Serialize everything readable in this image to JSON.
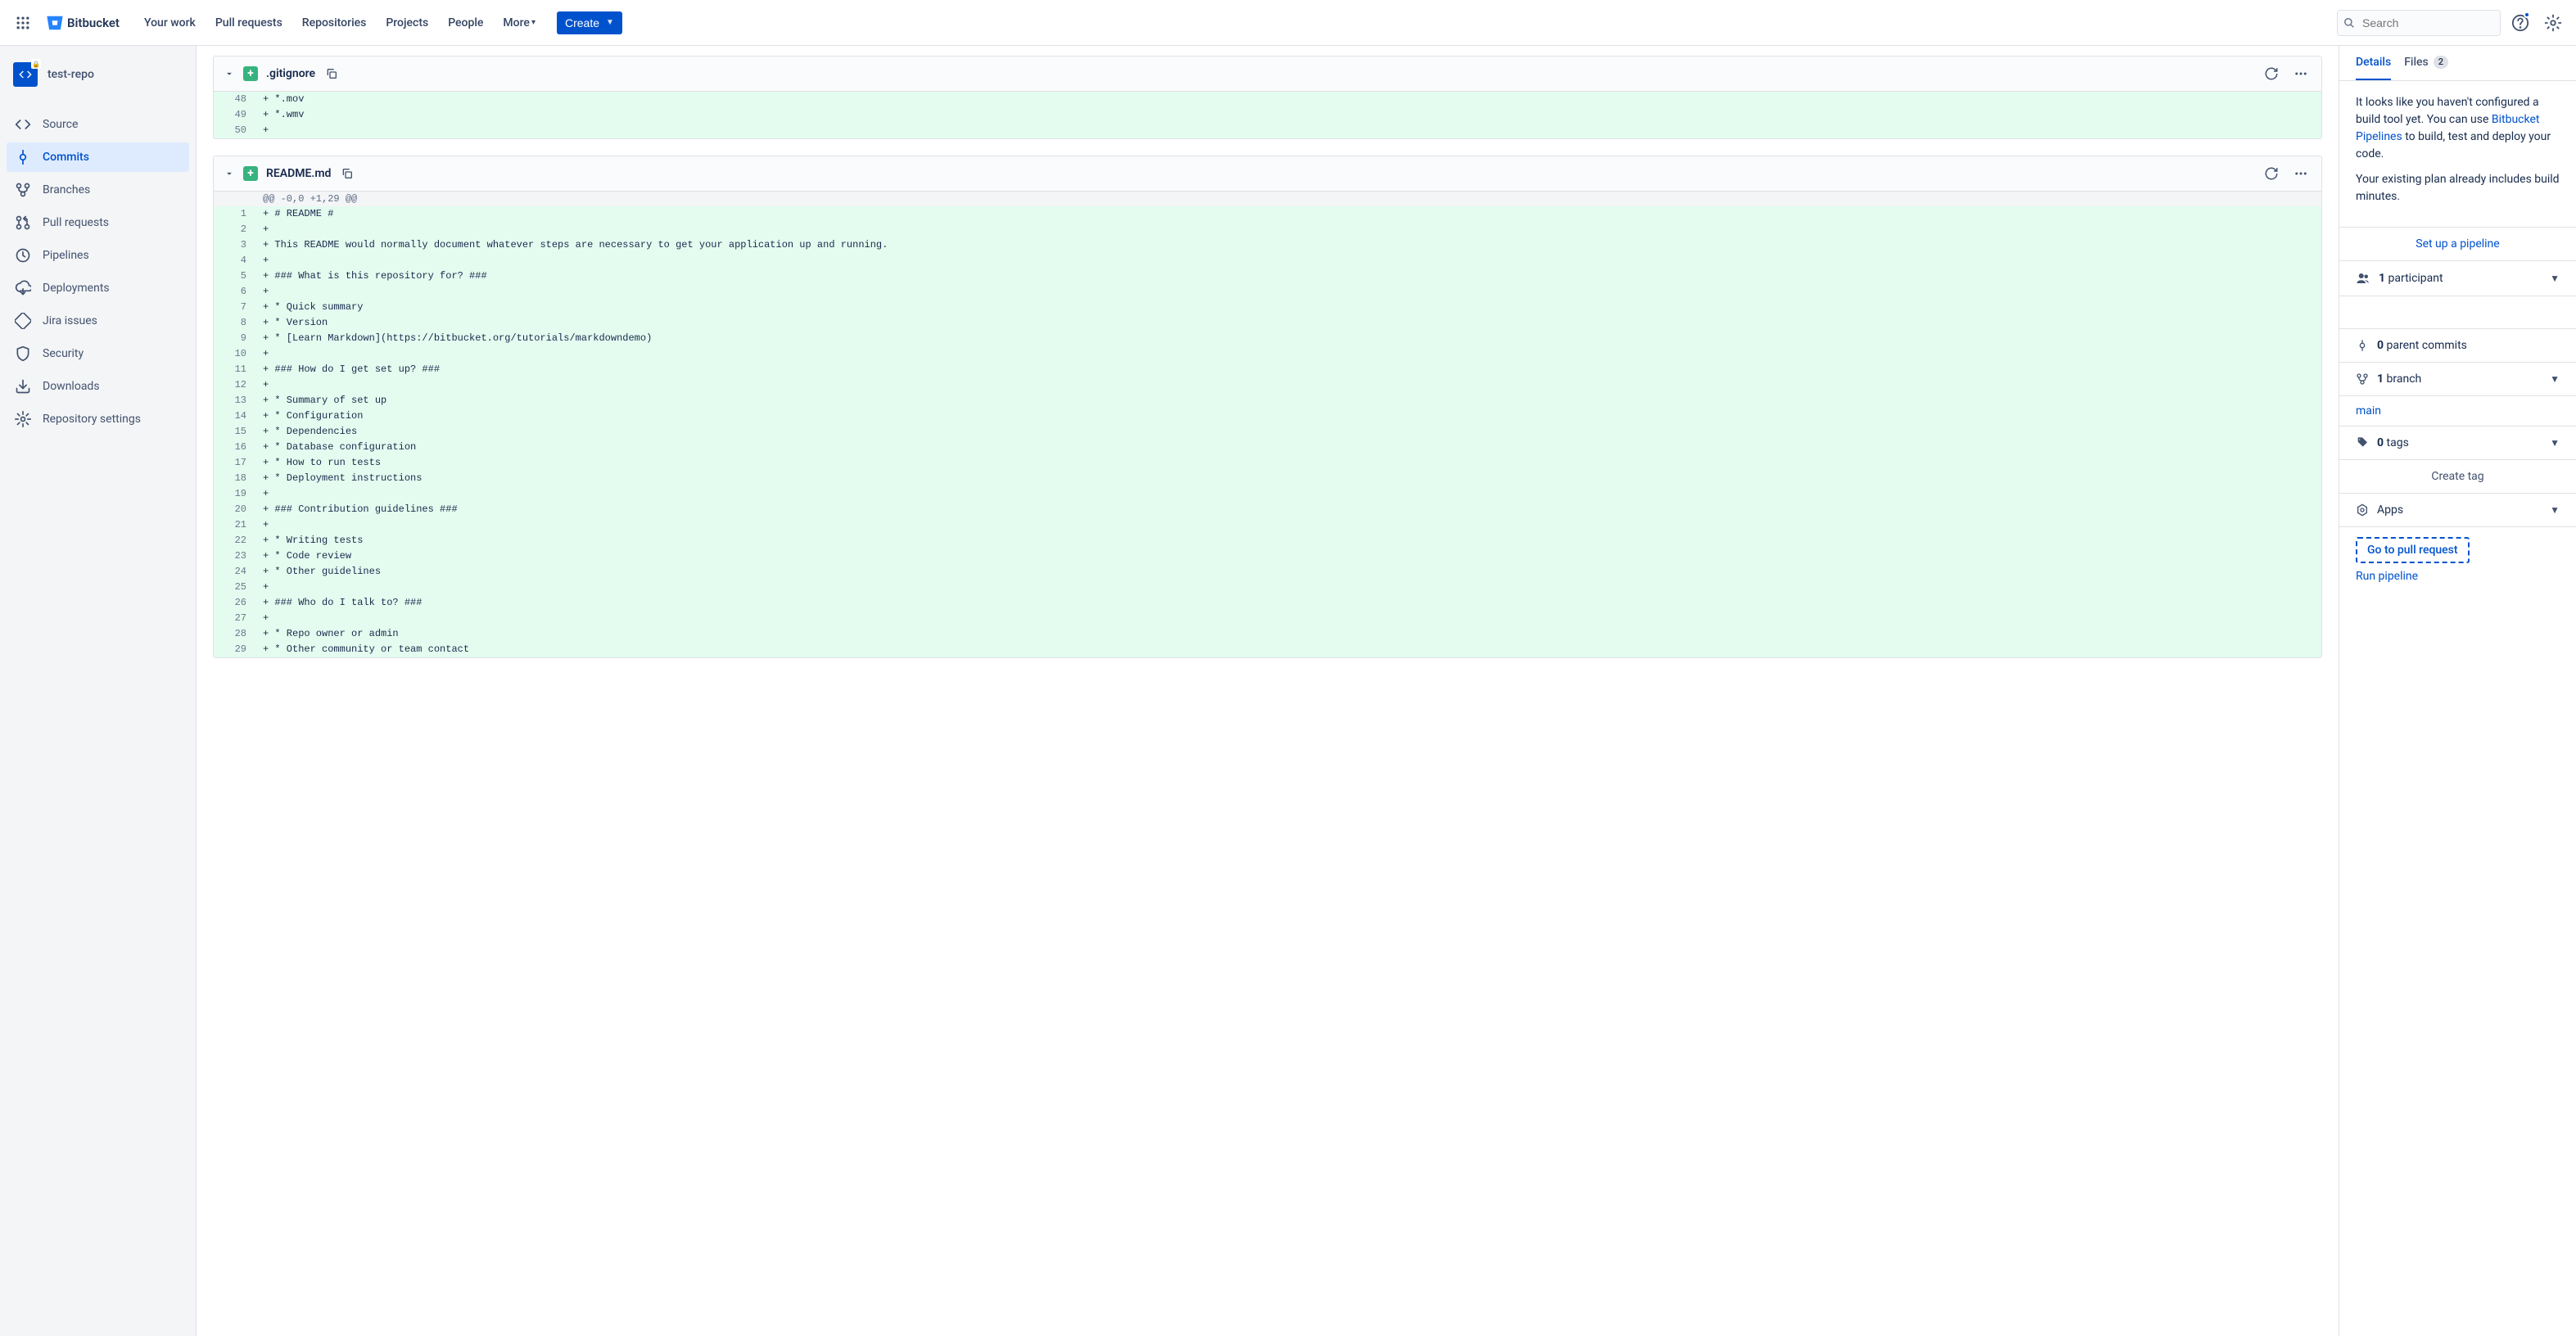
{
  "topnav": {
    "logo": "Bitbucket",
    "links": [
      "Your work",
      "Pull requests",
      "Repositories",
      "Projects",
      "People",
      "More"
    ],
    "create": "Create",
    "search_placeholder": "Search"
  },
  "sidebar": {
    "repo": "test-repo",
    "items": [
      {
        "icon": "code",
        "label": "Source"
      },
      {
        "icon": "commits",
        "label": "Commits",
        "active": true
      },
      {
        "icon": "branch",
        "label": "Branches"
      },
      {
        "icon": "pr",
        "label": "Pull requests"
      },
      {
        "icon": "pipelines",
        "label": "Pipelines"
      },
      {
        "icon": "deploy",
        "label": "Deployments"
      },
      {
        "icon": "jira",
        "label": "Jira issues"
      },
      {
        "icon": "shield",
        "label": "Security"
      },
      {
        "icon": "download",
        "label": "Downloads"
      },
      {
        "icon": "settings",
        "label": "Repository settings"
      }
    ]
  },
  "diffs": [
    {
      "filename": ".gitignore",
      "lines": [
        {
          "n": 48,
          "t": "add",
          "c": "+ *.mov"
        },
        {
          "n": 49,
          "t": "add",
          "c": "+ *.wmv"
        },
        {
          "n": 50,
          "t": "add",
          "c": "+ "
        }
      ]
    },
    {
      "filename": "README.md",
      "hunk": "@@ -0,0 +1,29 @@",
      "lines": [
        {
          "n": 1,
          "t": "add",
          "c": "+ # README #"
        },
        {
          "n": 2,
          "t": "add",
          "c": "+ "
        },
        {
          "n": 3,
          "t": "add",
          "c": "+ This README would normally document whatever steps are necessary to get your application up and running."
        },
        {
          "n": 4,
          "t": "add",
          "c": "+ "
        },
        {
          "n": 5,
          "t": "add",
          "c": "+ ### What is this repository for? ###"
        },
        {
          "n": 6,
          "t": "add",
          "c": "+ "
        },
        {
          "n": 7,
          "t": "add",
          "c": "+ * Quick summary"
        },
        {
          "n": 8,
          "t": "add",
          "c": "+ * Version"
        },
        {
          "n": 9,
          "t": "add",
          "c": "+ * [Learn Markdown](https://bitbucket.org/tutorials/markdowndemo)"
        },
        {
          "n": 10,
          "t": "add",
          "c": "+ "
        },
        {
          "n": 11,
          "t": "add",
          "c": "+ ### How do I get set up? ###"
        },
        {
          "n": 12,
          "t": "add",
          "c": "+ "
        },
        {
          "n": 13,
          "t": "add",
          "c": "+ * Summary of set up"
        },
        {
          "n": 14,
          "t": "add",
          "c": "+ * Configuration"
        },
        {
          "n": 15,
          "t": "add",
          "c": "+ * Dependencies"
        },
        {
          "n": 16,
          "t": "add",
          "c": "+ * Database configuration"
        },
        {
          "n": 17,
          "t": "add",
          "c": "+ * How to run tests"
        },
        {
          "n": 18,
          "t": "add",
          "c": "+ * Deployment instructions"
        },
        {
          "n": 19,
          "t": "add",
          "c": "+ "
        },
        {
          "n": 20,
          "t": "add",
          "c": "+ ### Contribution guidelines ###"
        },
        {
          "n": 21,
          "t": "add",
          "c": "+ "
        },
        {
          "n": 22,
          "t": "add",
          "c": "+ * Writing tests"
        },
        {
          "n": 23,
          "t": "add",
          "c": "+ * Code review"
        },
        {
          "n": 24,
          "t": "add",
          "c": "+ * Other guidelines"
        },
        {
          "n": 25,
          "t": "add",
          "c": "+ "
        },
        {
          "n": 26,
          "t": "add",
          "c": "+ ### Who do I talk to? ###"
        },
        {
          "n": 27,
          "t": "add",
          "c": "+ "
        },
        {
          "n": 28,
          "t": "add",
          "c": "+ * Repo owner or admin"
        },
        {
          "n": 29,
          "t": "add",
          "c": "+ * Other community or team contact"
        }
      ]
    }
  ],
  "right": {
    "tabs": {
      "details": "Details",
      "files": "Files",
      "files_count": "2"
    },
    "build_text_1": "It looks like you haven't configured a build tool yet. You can use ",
    "build_link": "Bitbucket Pipelines",
    "build_text_2": " to build, test and deploy your code.",
    "plan_text": "Your existing plan already includes build minutes.",
    "setup_pipeline": "Set up a pipeline",
    "participants_count": "1",
    "participants_label": " participant",
    "parent_count": "0",
    "parent_label": " parent commits",
    "branch_count": "1",
    "branch_label": " branch",
    "branch_name": "main",
    "tags_count": "0",
    "tags_label": " tags",
    "create_tag": "Create tag",
    "apps": "Apps",
    "go_pr": "Go to pull request",
    "run_pipeline": "Run pipeline"
  }
}
